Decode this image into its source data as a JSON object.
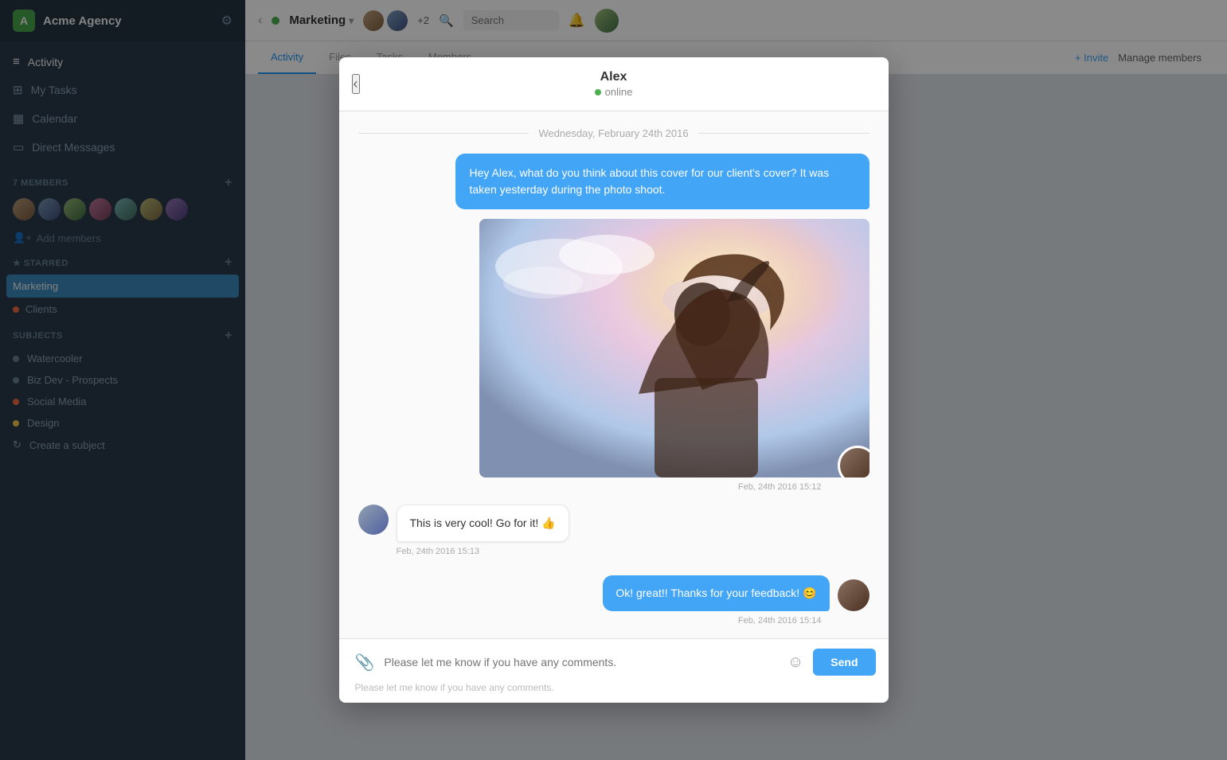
{
  "app": {
    "name": "Acme Agency",
    "logo_letter": "A"
  },
  "sidebar": {
    "nav_items": [
      {
        "id": "activity",
        "label": "Activity",
        "icon": "≡"
      },
      {
        "id": "my-tasks",
        "label": "My Tasks",
        "icon": "⊞"
      },
      {
        "id": "calendar",
        "label": "Calendar",
        "icon": "▦"
      },
      {
        "id": "direct-messages",
        "label": "Direct Messages",
        "icon": "▭"
      }
    ],
    "members_section": {
      "title": "7 MEMBERS",
      "add_members_label": "Add members"
    },
    "starred_section": {
      "title": "★ STARRED",
      "items": [
        {
          "id": "marketing",
          "label": "Marketing",
          "active": true
        },
        {
          "id": "clients",
          "label": "Clients",
          "active": false,
          "dot_color": "orange"
        }
      ]
    },
    "subjects_section": {
      "title": "SUBJECTS",
      "items": [
        {
          "id": "watercooler",
          "label": "Watercooler",
          "dot_color": "gray"
        },
        {
          "id": "biz-dev",
          "label": "Biz Dev - Prospects",
          "dot_color": "gray"
        },
        {
          "id": "social-media",
          "label": "Social Media",
          "dot_color": "orange"
        },
        {
          "id": "design",
          "label": "Design",
          "dot_color": "yellow"
        },
        {
          "id": "create",
          "label": "Create a subject",
          "icon": "↻"
        }
      ]
    }
  },
  "channel": {
    "name": "Marketing",
    "tabs": [
      {
        "id": "activity",
        "label": "Activity",
        "active": true
      },
      {
        "id": "files",
        "label": "Files"
      },
      {
        "id": "tasks",
        "label": "Tasks"
      },
      {
        "id": "members",
        "label": "Members"
      }
    ],
    "invite_label": "+ Invite",
    "manage_label": "Manage members",
    "members_count": "+2"
  },
  "modal": {
    "back_label": "‹",
    "user_name": "Alex",
    "user_status": "online",
    "date_separator": "Wednesday, February 24th 2016",
    "messages": [
      {
        "id": "msg1",
        "type": "outgoing",
        "text": "Hey Alex, what do you think about this cover for our client's cover? It was taken yesterday during the photo shoot.",
        "has_image": true,
        "timestamp": "Feb, 24th 2016 15:12"
      },
      {
        "id": "msg2",
        "type": "incoming",
        "text": "This is very cool! Go for it! 👍",
        "timestamp": "Feb, 24th 2016 15:13"
      },
      {
        "id": "msg3",
        "type": "outgoing",
        "text": "Ok! great!! Thanks for your feedback! 😊",
        "timestamp": "Feb, 24th 2016 15:14"
      }
    ],
    "footer": {
      "placeholder": "Please let me know if you have any comments.",
      "send_label": "Send"
    }
  }
}
